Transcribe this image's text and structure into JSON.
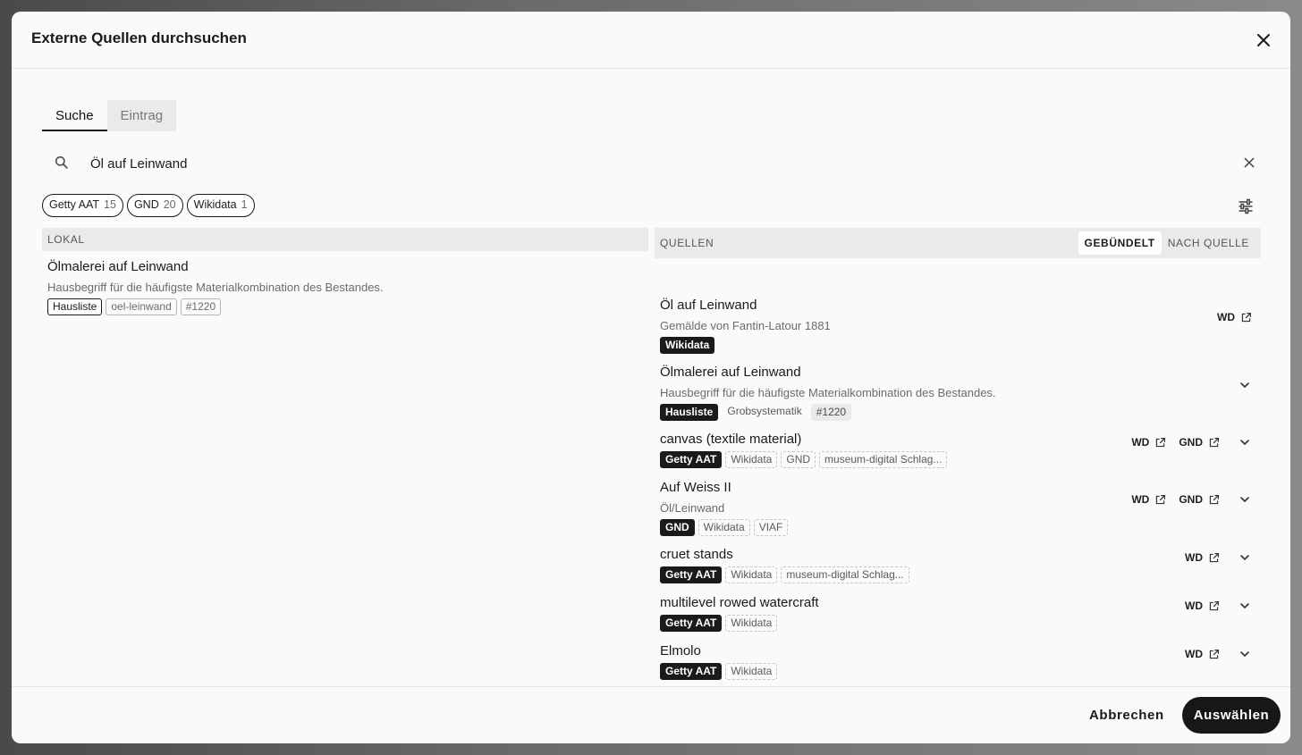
{
  "modal": {
    "title": "Externe Quellen durchsuchen"
  },
  "tabs": [
    {
      "label": "Suche",
      "active": true
    },
    {
      "label": "Eintrag",
      "active": false
    }
  ],
  "search": {
    "value": "Öl auf Leinwand",
    "placeholder": ""
  },
  "source_chips": [
    {
      "label": "Getty AAT",
      "count": "15"
    },
    {
      "label": "GND",
      "count": "20"
    },
    {
      "label": "Wikidata",
      "count": "1"
    }
  ],
  "local": {
    "header": "LOKAL",
    "items": [
      {
        "title": "Ölmalerei auf Leinwand",
        "desc": "Hausbegriff für die häufigste Materialkombination des Bestandes.",
        "badges": [
          "Hausliste",
          "oel-leinwand",
          "#1220"
        ]
      }
    ]
  },
  "sources": {
    "header": "QUELLEN",
    "view_toggle": [
      "GEBÜNDELT",
      "NACH QUELLE"
    ],
    "results": [
      {
        "title": "Öl auf Leinwand",
        "desc": "Gemälde von Fantin-Latour 1881",
        "badges": [
          {
            "text": "Wikidata",
            "style": "solid"
          }
        ],
        "links": [
          "WD"
        ],
        "expandable": false
      },
      {
        "title": "Ölmalerei auf Leinwand",
        "desc": "Hausbegriff für die häufigste Materialkombination des Bestandes.",
        "badges": [
          {
            "text": "Hausliste",
            "style": "solid"
          },
          {
            "text": "Grobsystematik",
            "style": "plain"
          },
          {
            "text": "#1220",
            "style": "gray"
          }
        ],
        "links": [],
        "expandable": true
      },
      {
        "title": "canvas (textile material)",
        "desc": "",
        "badges": [
          {
            "text": "Getty AAT",
            "style": "solid"
          },
          {
            "text": "Wikidata",
            "style": "dashed"
          },
          {
            "text": "GND",
            "style": "dashed"
          },
          {
            "text": "museum-digital Schlag...",
            "style": "dashed"
          }
        ],
        "links": [
          "WD",
          "GND"
        ],
        "expandable": true
      },
      {
        "title": "Auf Weiss II",
        "desc": "Öl/Leinwand",
        "badges": [
          {
            "text": "GND",
            "style": "solid"
          },
          {
            "text": "Wikidata",
            "style": "dashed"
          },
          {
            "text": "VIAF",
            "style": "dashed"
          }
        ],
        "links": [
          "WD",
          "GND"
        ],
        "expandable": true
      },
      {
        "title": "cruet stands",
        "desc": "",
        "badges": [
          {
            "text": "Getty AAT",
            "style": "solid"
          },
          {
            "text": "Wikidata",
            "style": "dashed"
          },
          {
            "text": "museum-digital Schlag...",
            "style": "dashed"
          }
        ],
        "links": [
          "WD"
        ],
        "expandable": true
      },
      {
        "title": "multilevel rowed watercraft",
        "desc": "",
        "badges": [
          {
            "text": "Getty AAT",
            "style": "solid"
          },
          {
            "text": "Wikidata",
            "style": "dashed"
          }
        ],
        "links": [
          "WD"
        ],
        "expandable": true
      },
      {
        "title": "Elmolo",
        "desc": "",
        "badges": [
          {
            "text": "Getty AAT",
            "style": "solid"
          },
          {
            "text": "Wikidata",
            "style": "dashed"
          }
        ],
        "links": [
          "WD"
        ],
        "expandable": true
      }
    ]
  },
  "footer": {
    "cancel_label": "Abbrechen",
    "confirm_label": "Auswählen"
  },
  "icons": {
    "close": "close-icon",
    "search": "search-icon",
    "clear": "clear-icon",
    "filter": "tune-icon",
    "external": "external-link-icon",
    "chevron": "chevron-down-icon"
  }
}
